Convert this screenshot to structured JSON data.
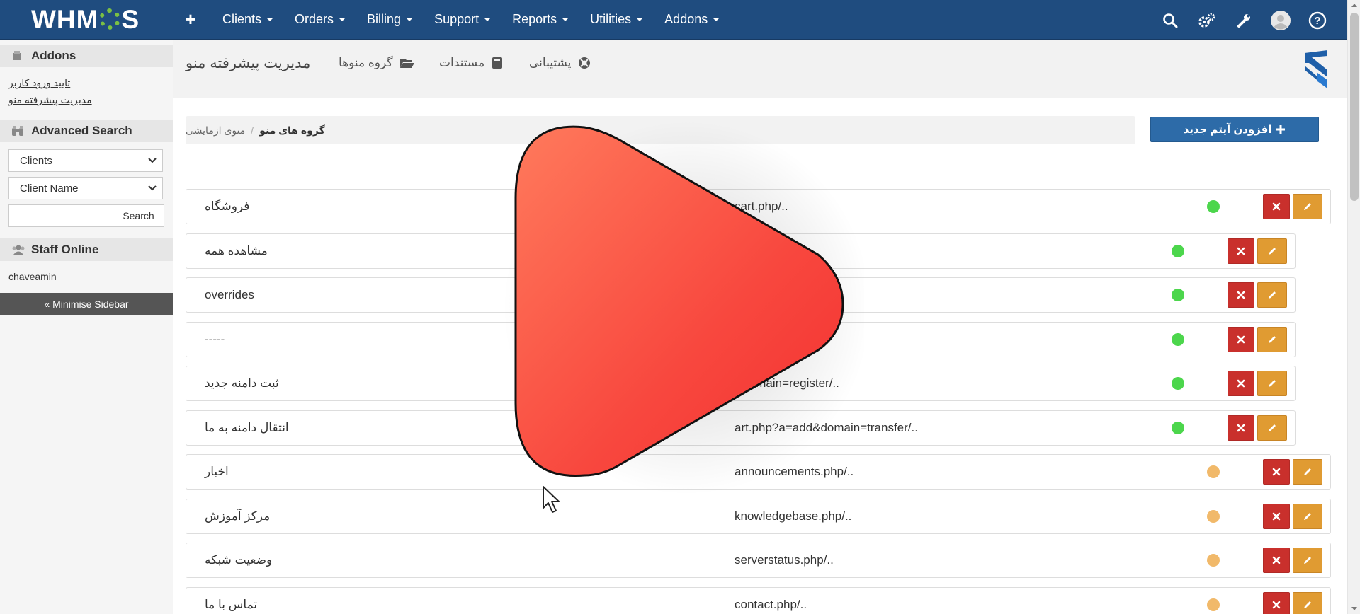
{
  "topnav": {
    "logo": {
      "text_before": "WHM",
      "text_after": "S"
    },
    "menu": [
      {
        "label": "Clients"
      },
      {
        "label": "Orders"
      },
      {
        "label": "Billing"
      },
      {
        "label": "Support"
      },
      {
        "label": "Reports"
      },
      {
        "label": "Utilities"
      },
      {
        "label": "Addons"
      }
    ],
    "right_icons": [
      "search-icon",
      "cogs-icon",
      "wrench-icon",
      "user-avatar-icon",
      "help-icon"
    ],
    "bg_color": "#1f4c7f"
  },
  "sidebar": {
    "addons": {
      "heading": "Addons",
      "links": [
        {
          "label": "تایید ورود کاربر"
        },
        {
          "label": "مدیریت پیشرفته منو"
        }
      ]
    },
    "advanced_search": {
      "heading": "Advanced Search",
      "type_select": "Clients",
      "field_select": "Client Name",
      "search_value": "",
      "search_button": "Search"
    },
    "staff_online": {
      "heading": "Staff Online",
      "staff": [
        "chaveamin"
      ]
    },
    "minimise_label": "« Minimise Sidebar"
  },
  "module_bar": {
    "title": "مدیریت پیشرفته منو",
    "links": [
      {
        "label": "گروه منوها",
        "icon": "folder-open-icon"
      },
      {
        "label": "مستندات",
        "icon": "book-icon"
      },
      {
        "label": "پشتیبانی",
        "icon": "life-ring-icon"
      }
    ]
  },
  "breadcrumb": {
    "items": [
      "گروه های منو",
      "منوی ازمایشی"
    ]
  },
  "add_button_label": "افزودن آیتم جدید",
  "menu_items": [
    {
      "name": "فروشگاه",
      "url": "cart.php/..",
      "status": "active",
      "level": 0
    },
    {
      "name": "مشاهده همه",
      "url": "",
      "status": "active",
      "level": 1
    },
    {
      "name": "overrides",
      "url": "",
      "status": "active",
      "level": 1
    },
    {
      "name": "-----",
      "url": "",
      "status": "active",
      "level": 1
    },
    {
      "name": "ثبت دامنه جدید",
      "url": "&domain=register/..",
      "status": "active",
      "level": 1
    },
    {
      "name": "انتقال دامنه به ما",
      "url": "art.php?a=add&domain=transfer/..",
      "status": "active",
      "level": 1
    },
    {
      "name": "اخبار",
      "url": "announcements.php/..",
      "status": "inactive",
      "level": 0
    },
    {
      "name": "مرکز آموزش",
      "url": "knowledgebase.php/..",
      "status": "inactive",
      "level": 0
    },
    {
      "name": "وضعیت شبکه",
      "url": "serverstatus.php/..",
      "status": "inactive",
      "level": 0
    },
    {
      "name": "تماس با ما",
      "url": "contact.php/..",
      "status": "inactive",
      "level": 0
    }
  ],
  "colors": {
    "active": "#4cd64c",
    "inactive": "#f1b96a",
    "delete": "#c9302c",
    "edit": "#e09b32",
    "primary": "#2d6ba8",
    "play": "#f8473e"
  },
  "overlay": {
    "icon": "play-icon"
  }
}
